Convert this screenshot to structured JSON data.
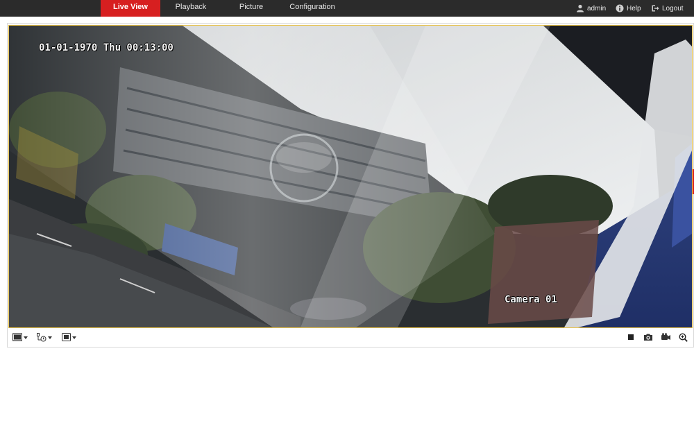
{
  "nav": {
    "tabs": [
      {
        "label": "Live View",
        "active": true
      },
      {
        "label": "Playback",
        "active": false
      },
      {
        "label": "Picture",
        "active": false
      },
      {
        "label": "Configuration",
        "active": false
      }
    ],
    "user": {
      "label": "admin",
      "icon": "user-icon"
    },
    "help": {
      "label": "Help",
      "icon": "info-icon"
    },
    "logout": {
      "label": "Logout",
      "icon": "logout-icon"
    }
  },
  "video": {
    "timestamp": "01-01-1970 Thu 00:13:00",
    "camera_name": "Camera 01"
  },
  "toolbar": {
    "left": [
      {
        "icon": "window-layout-icon",
        "dropdown": true
      },
      {
        "icon": "stream-type-icon",
        "dropdown": true
      },
      {
        "icon": "plugin-icon",
        "dropdown": true
      }
    ],
    "right": [
      {
        "icon": "stop-icon"
      },
      {
        "icon": "capture-icon"
      },
      {
        "icon": "record-icon"
      },
      {
        "icon": "zoom-icon"
      }
    ]
  },
  "colors": {
    "accent": "#d71f20",
    "topbar": "#2b2b2b",
    "video_border": "#e8c24a"
  }
}
